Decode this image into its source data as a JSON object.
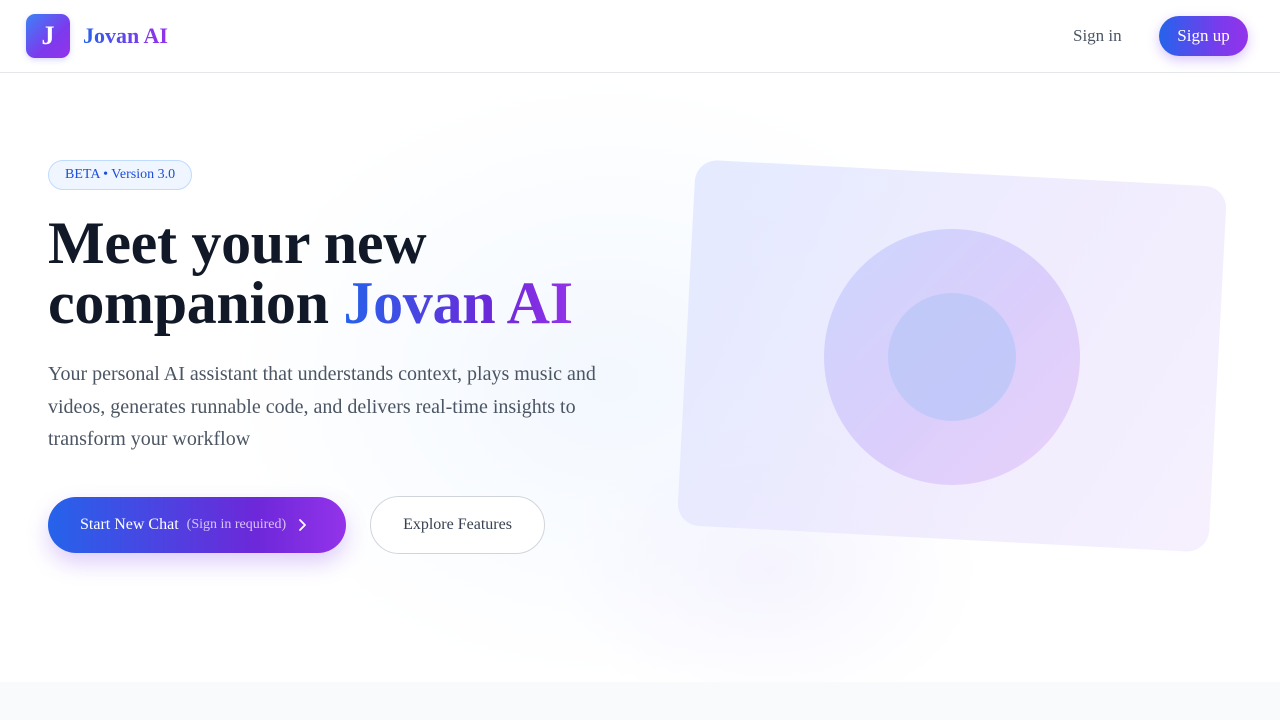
{
  "header": {
    "logo_letter": "J",
    "brand_name": "Jovan AI",
    "signin_label": "Sign in",
    "signup_label": "Sign up"
  },
  "hero": {
    "badge": "BETA • Version 3.0",
    "headline_line1": "Meet your new",
    "headline_line2_prefix": "companion",
    "headline_accent": "Jovan AI",
    "subtitle": "Your personal AI assistant that understands context, plays music and videos, generates runnable code, and delivers real-time insights to transform your workflow",
    "primary_cta": {
      "label": "Start New Chat",
      "note": "(Sign in required)",
      "icon": "chevron-right-icon"
    },
    "secondary_cta_label": "Explore Features"
  },
  "colors": {
    "brand_blue": "#2563eb",
    "brand_purple": "#9333ea",
    "heading": "#111827",
    "body_text": "#4b5563",
    "badge_text": "#1d4ed8",
    "badge_bg": "#eff6ff"
  }
}
